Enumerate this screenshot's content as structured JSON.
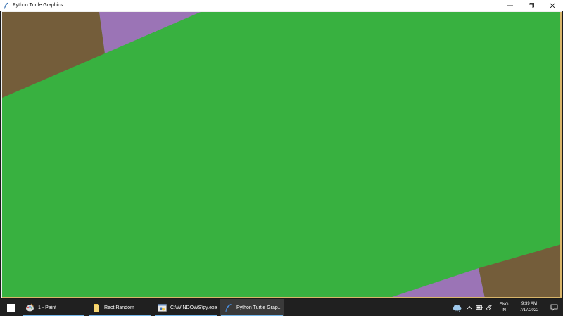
{
  "window": {
    "title": "Python Turtle Graphics",
    "controls": {
      "minimize_glyph": "—",
      "maximize_glyph": "❐",
      "close_glyph": "✕"
    }
  },
  "canvas": {
    "background_color": "#38b140",
    "shape_colors": {
      "olive": "#745d3a",
      "purple": "#9b74b6",
      "green": "#38b140"
    }
  },
  "taskbar": {
    "items": [
      {
        "label": "1 - Paint",
        "icon": "paint-icon",
        "active": false
      },
      {
        "label": "Rect Random",
        "icon": "folder-icon",
        "active": false
      },
      {
        "label": "C:\\WINDOWS\\py.exe",
        "icon": "python-console-icon",
        "active": false
      },
      {
        "label": "Python Turtle Grap...",
        "icon": "turtle-feather-icon",
        "active": true
      }
    ],
    "tray": {
      "language_line1": "ENG",
      "language_line2": "IN",
      "time": "9:39 AM",
      "date": "7/17/2022"
    },
    "accent_color": "#76b9ed"
  }
}
